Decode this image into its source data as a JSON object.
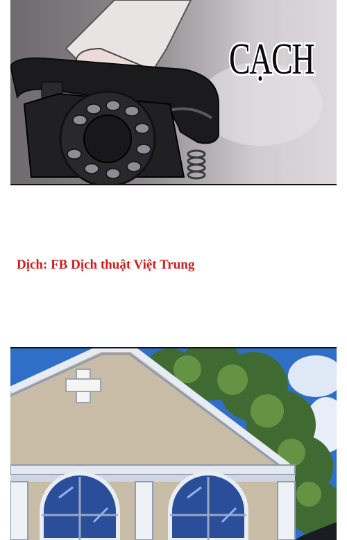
{
  "sfx_text": "CẠCH",
  "credit_text": "Dịch: FB Dịch thuật Việt Trung",
  "colors": {
    "credit_red": "#d21c1c",
    "phone_black": "#1b1b1d",
    "sky_blue": "#2f6fc7",
    "building_beige": "#c9bca6",
    "foliage_green": "#3f6b33"
  },
  "icons": {
    "cross": "church-cross-icon"
  }
}
